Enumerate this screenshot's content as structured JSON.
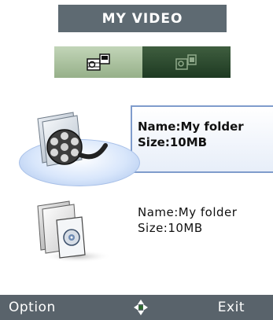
{
  "title": "MY VIDEO",
  "tabs": [
    {
      "icon": "video-folder-icon",
      "state": "active"
    },
    {
      "icon": "video-file-icon",
      "state": "inactive"
    }
  ],
  "items": [
    {
      "icon": "video-folder-reel-icon",
      "name_text": "Name:My folder",
      "size_text": "Size:10MB",
      "selected": true
    },
    {
      "icon": "video-folder-disc-icon",
      "name_text": "Name:My folder",
      "size_text": "Size:10MB",
      "selected": false
    }
  ],
  "softkeys": {
    "left": "Option",
    "right": "Exit",
    "center_icon": "navigation-arrows-icon"
  },
  "colors": {
    "title_bg": "#5e6a72",
    "tab_active": "#a9c29b",
    "tab_inactive": "#2d4a30",
    "selection_border": "#7f9ccc",
    "softkey_bg": "#59636b"
  }
}
